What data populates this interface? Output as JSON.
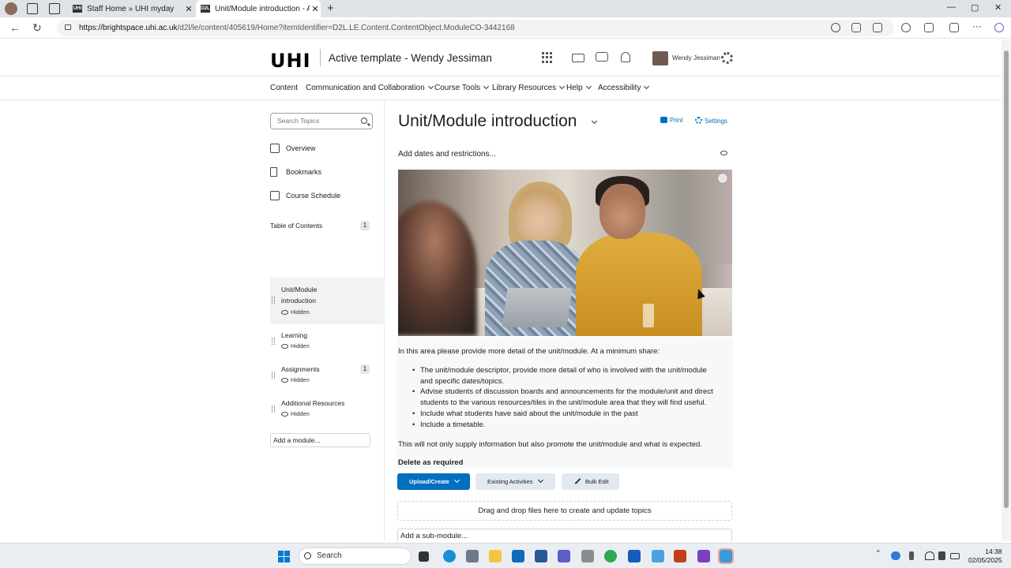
{
  "browser": {
    "tabs": [
      {
        "label": "Staff Home » UHI myday",
        "favicon": "UHI"
      },
      {
        "label": "Unit/Module introduction - Active",
        "favicon": "D2L"
      }
    ],
    "url_host": "https://brightspace.uhi.ac.uk",
    "url_path": "/d2l/le/content/405619/Home?itemIdentifier=D2L.LE.Content.ContentObject.ModuleCO-3442168"
  },
  "header": {
    "logo": "UHI",
    "course_title": "Active template - Wendy Jessiman",
    "user_name": "Wendy Jessiman"
  },
  "nav": {
    "items": [
      {
        "label": "Content",
        "has_menu": false
      },
      {
        "label": "Communication and Collaboration",
        "has_menu": true
      },
      {
        "label": "Course Tools",
        "has_menu": true
      },
      {
        "label": "Library Resources",
        "has_menu": true
      },
      {
        "label": "Help",
        "has_menu": true
      },
      {
        "label": "Accessibility",
        "has_menu": true
      }
    ]
  },
  "sidebar": {
    "search_placeholder": "Search Topics",
    "links": [
      {
        "label": "Overview",
        "icon": "presentation-icon"
      },
      {
        "label": "Bookmarks",
        "icon": "bookmark-icon"
      },
      {
        "label": "Course Schedule",
        "icon": "calendar-icon"
      }
    ],
    "toc_label": "Table of Contents",
    "toc_count": "1",
    "modules": [
      {
        "line1": "Unit/Module",
        "line2": "introduction",
        "status": "Hidden",
        "count": ""
      },
      {
        "line1": "Learning",
        "line2": "",
        "status": "Hidden",
        "count": ""
      },
      {
        "line1": "Assignments",
        "line2": "",
        "status": "Hidden",
        "count": "1"
      },
      {
        "line1": "Additional Resources",
        "line2": "",
        "status": "Hidden",
        "count": ""
      }
    ],
    "add_module": "Add a module..."
  },
  "main": {
    "title": "Unit/Module introduction",
    "print_label": "Print",
    "settings_label": "Settings",
    "add_dates": "Add dates and restrictions...",
    "intro": "In this area please provide more detail of the unit/module. At a minimum share:",
    "bullets": [
      {
        "l1": "The unit/module descriptor, provide more detail of who is involved with the unit/module",
        "l2": "and specific dates/topics."
      },
      {
        "l1": "Advise students of discussion boards and announcements for the module/unit and direct",
        "l2": "students to the various resources/tiles in the unit/module area that they will find useful."
      },
      {
        "l1": "Include what students have said about the unit/module in the past",
        "l2": ""
      },
      {
        "l1": "Include a timetable.",
        "l2": ""
      }
    ],
    "outro": "This will not only supply information but also promote the unit/module and what is expected.",
    "delete_note": "Delete as required",
    "buttons": {
      "upload": "Upload/Create",
      "existing": "Existing Activities",
      "bulk": "Bulk Edit"
    },
    "dropzone": "Drag and drop files here to create and update topics",
    "add_submodule": "Add a sub-module..."
  },
  "taskbar": {
    "search": "Search",
    "time": "14:38",
    "date": "02/05/2025"
  },
  "colors": {
    "accent": "#006fbf",
    "tab_bar": "#dfe3e8",
    "selected_item": "#f1f2f4"
  }
}
